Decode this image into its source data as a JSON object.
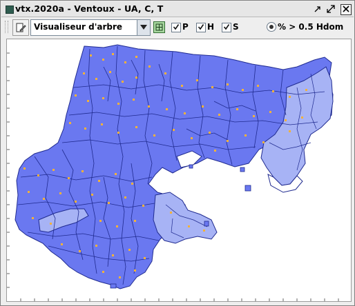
{
  "window": {
    "title": "vtx.2020a - Ventoux - UA, C, T",
    "icon": "app-window-icon",
    "controls": [
      "minimize",
      "maximize",
      "close"
    ]
  },
  "toolbar": {
    "viewer_button_icon": "pencil-document-icon",
    "viewer_select": {
      "selected": "Visualiseur d'arbre"
    },
    "settings_icon": "settings-grid-icon",
    "checkboxes": [
      {
        "label": "P",
        "checked": true
      },
      {
        "label": "H",
        "checked": true
      },
      {
        "label": "S",
        "checked": true
      }
    ],
    "radio": {
      "label": "% > 0.5 Hdom",
      "selected": true
    }
  },
  "colors": {
    "stand_fill": "#6a78f0",
    "stand_fill_light": "#a7b3f5",
    "stand_border": "#1f2a8f",
    "tree_point": "#f2b23a",
    "canvas_bg": "#ffffff"
  }
}
